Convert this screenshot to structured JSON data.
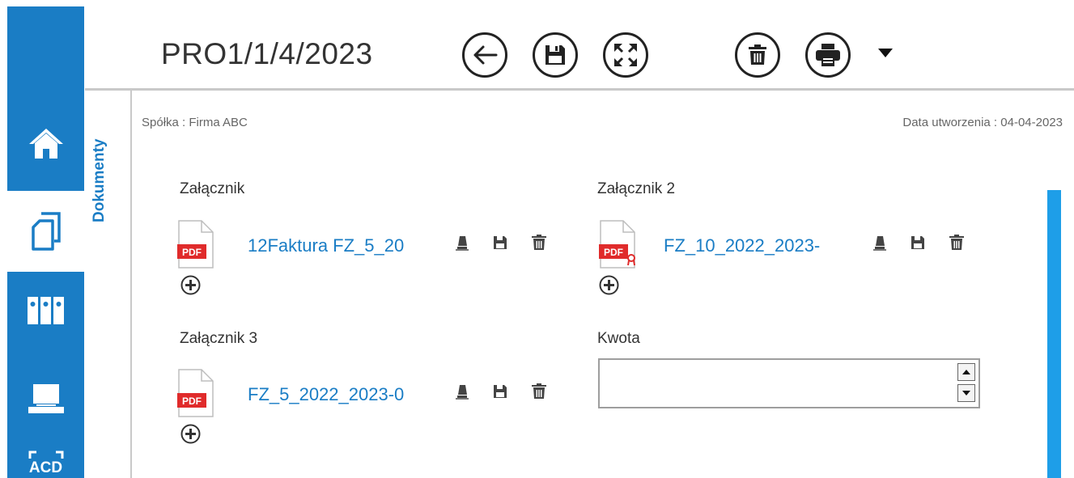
{
  "nav": {
    "items": [
      {
        "icon": "home-icon",
        "active": false
      },
      {
        "icon": "documents-icon",
        "active": true
      },
      {
        "icon": "binders-icon",
        "active": false
      },
      {
        "icon": "scanner-icon",
        "active": false
      },
      {
        "icon": "ocr-acd-icon",
        "active": false,
        "label": "ACD"
      }
    ]
  },
  "header": {
    "title": "PRO1/1/4/2023",
    "toolbar": [
      "back-icon",
      "save-icon",
      "fullscreen-icon",
      "delete-icon",
      "print-icon",
      "dropdown-caret-icon"
    ]
  },
  "side_tab": {
    "label": "Dokumenty"
  },
  "meta": {
    "company": "Spółka : Firma ABC",
    "created": "Data utworzenia : 04-04-2023"
  },
  "attachments": [
    {
      "label": "Załącznik",
      "file_name": "12Faktura FZ_5_20",
      "signed": false
    },
    {
      "label": "Załącznik 2",
      "file_name": "FZ_10_2022_2023-",
      "signed": true
    },
    {
      "label": "Załącznik 3",
      "file_name": "FZ_5_2022_2023-0",
      "signed": false
    }
  ],
  "amount": {
    "label": "Kwota",
    "value": ""
  },
  "colors": {
    "accent": "#1a7dc5",
    "scrollbar": "#1e9ee8",
    "pdf_red": "#e02b2b"
  }
}
